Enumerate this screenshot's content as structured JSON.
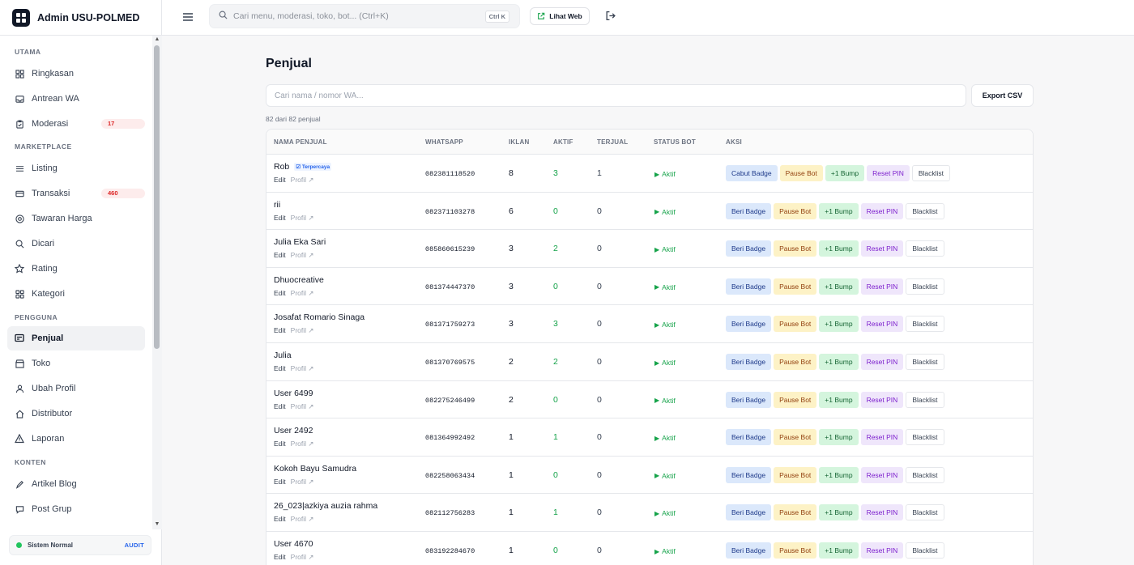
{
  "app": {
    "title": "Admin USU-POLMED"
  },
  "sidebar": {
    "sections": [
      {
        "label": "UTAMA"
      },
      {
        "label": "MARKETPLACE"
      },
      {
        "label": "PENGGUNA"
      },
      {
        "label": "KONTEN"
      }
    ],
    "items": [
      {
        "label": "Ringkasan",
        "icon": "grid-icon"
      },
      {
        "label": "Antrean WA",
        "icon": "inbox-icon"
      },
      {
        "label": "Moderasi",
        "icon": "clipboard-icon",
        "count": "17"
      },
      {
        "label": "Listing",
        "icon": "list-icon"
      },
      {
        "label": "Transaksi",
        "icon": "card-icon",
        "count": "460"
      },
      {
        "label": "Tawaran Harga",
        "icon": "offer-icon"
      },
      {
        "label": "Dicari",
        "icon": "search-icon"
      },
      {
        "label": "Rating",
        "icon": "star-icon"
      },
      {
        "label": "Kategori",
        "icon": "category-icon"
      },
      {
        "label": "Penjual",
        "icon": "seller-icon",
        "active": true
      },
      {
        "label": "Toko",
        "icon": "store-icon"
      },
      {
        "label": "Ubah Profil",
        "icon": "user-icon"
      },
      {
        "label": "Distributor",
        "icon": "home-icon"
      },
      {
        "label": "Laporan",
        "icon": "warning-icon"
      },
      {
        "label": "Artikel Blog",
        "icon": "article-icon"
      },
      {
        "label": "Post Grup",
        "icon": "post-icon"
      }
    ],
    "status": {
      "text": "Sistem Normal",
      "audit": "AUDIT",
      "color": "#22c55e"
    }
  },
  "topbar": {
    "search_placeholder": "Cari menu, moderasi, toko, bot... (Ctrl+K)",
    "shortcut": "Ctrl K",
    "lihat_web": "Lihat Web"
  },
  "main": {
    "title": "Penjual",
    "filter_placeholder": "Cari nama / nomor WA...",
    "export_label": "Export CSV",
    "count_text": "82 dari 82 penjual",
    "columns": [
      "NAMA PENJUAL",
      "WHATSAPP",
      "IKLAN",
      "AKTIF",
      "TERJUAL",
      "STATUS BOT",
      "AKSI"
    ],
    "row_links": {
      "edit": "Edit",
      "profile": "Profil ↗"
    },
    "bot_active_label": "Aktif",
    "trusted_label": "Terpercaya",
    "actions": {
      "give_badge": "Beri Badge",
      "revoke_badge": "Cabut Badge",
      "pause_bot": "Pause Bot",
      "bump": "+1 Bump",
      "reset_pin": "Reset PIN",
      "blacklist": "Blacklist"
    },
    "rows": [
      {
        "name": "Rob",
        "trusted": true,
        "whatsapp": "082381118520",
        "iklan": "8",
        "aktif": "3",
        "terjual": "1"
      },
      {
        "name": "rii",
        "trusted": false,
        "whatsapp": "082371103278",
        "iklan": "6",
        "aktif": "0",
        "terjual": "0"
      },
      {
        "name": "Julia Eka Sari",
        "trusted": false,
        "whatsapp": "085860615239",
        "iklan": "3",
        "aktif": "2",
        "terjual": "0"
      },
      {
        "name": "Dhuocreative",
        "trusted": false,
        "whatsapp": "081374447370",
        "iklan": "3",
        "aktif": "0",
        "terjual": "0"
      },
      {
        "name": "Josafat Romario Sinaga",
        "trusted": false,
        "whatsapp": "081371759273",
        "iklan": "3",
        "aktif": "3",
        "terjual": "0"
      },
      {
        "name": "Julia",
        "trusted": false,
        "whatsapp": "081370769575",
        "iklan": "2",
        "aktif": "2",
        "terjual": "0"
      },
      {
        "name": "User 6499",
        "trusted": false,
        "whatsapp": "082275246499",
        "iklan": "2",
        "aktif": "0",
        "terjual": "0"
      },
      {
        "name": "User 2492",
        "trusted": false,
        "whatsapp": "081364992492",
        "iklan": "1",
        "aktif": "1",
        "terjual": "0"
      },
      {
        "name": "Kokoh Bayu Samudra",
        "trusted": false,
        "whatsapp": "082258063434",
        "iklan": "1",
        "aktif": "0",
        "terjual": "0"
      },
      {
        "name": "26_023|azkiya auzia rahma",
        "trusted": false,
        "whatsapp": "082112756283",
        "iklan": "1",
        "aktif": "1",
        "terjual": "0"
      },
      {
        "name": "User 4670",
        "trusted": false,
        "whatsapp": "083192284670",
        "iklan": "1",
        "aktif": "0",
        "terjual": "0"
      }
    ]
  },
  "colors": {
    "accent": "#2563eb",
    "success": "#16a34a",
    "danger": "#dc2626"
  }
}
